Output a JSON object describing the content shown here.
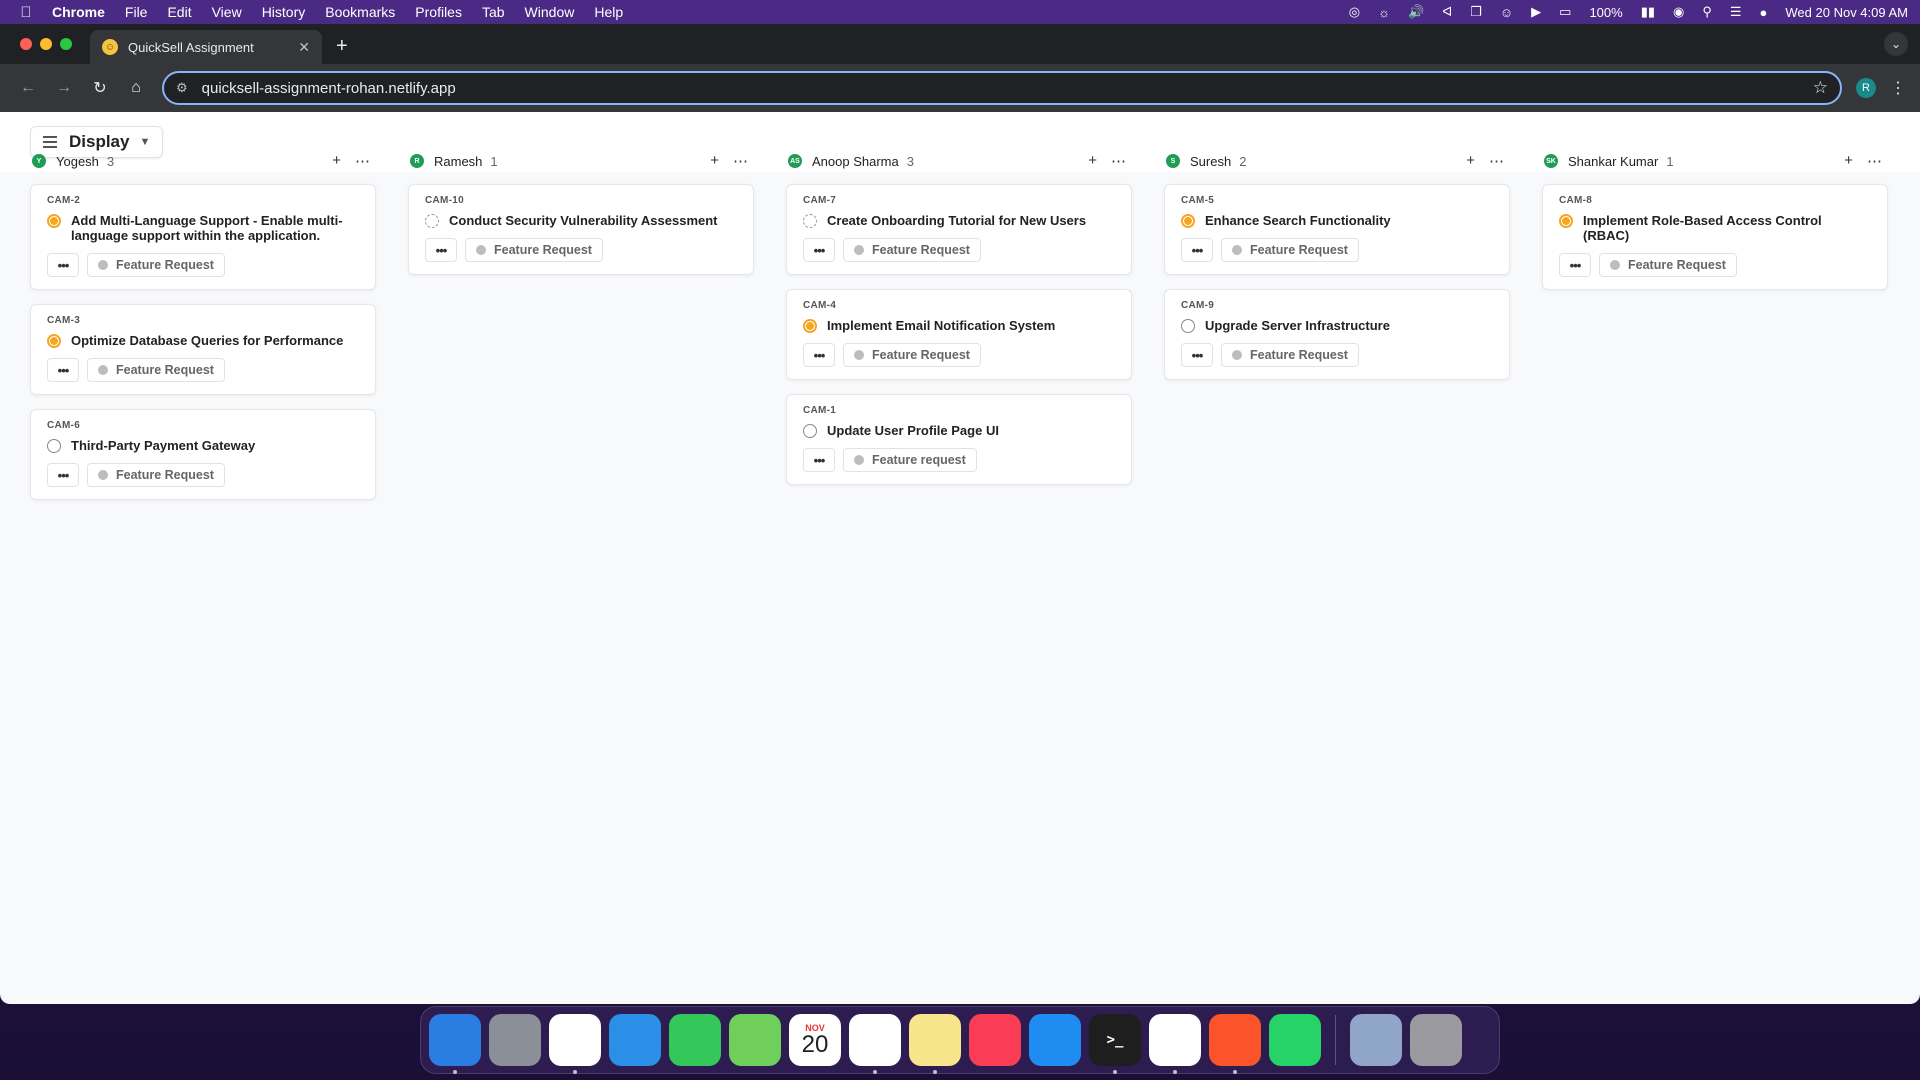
{
  "menubar": {
    "app": "Chrome",
    "items": [
      "File",
      "Edit",
      "View",
      "History",
      "Bookmarks",
      "Profiles",
      "Tab",
      "Window",
      "Help"
    ],
    "battery": "100%",
    "datetime": "Wed 20 Nov  4:09 AM"
  },
  "browser": {
    "tab_title": "QuickSell Assignment",
    "url": "quicksell-assignment-rohan.netlify.app",
    "profile_initial": "R"
  },
  "app": {
    "display_label": "Display"
  },
  "columns": [
    {
      "initials": "Y",
      "name": "Yogesh",
      "count": "3",
      "cards": [
        {
          "id": "CAM-2",
          "title": "Add Multi-Language Support - Enable multi-language support within the application.",
          "status": "progress",
          "tag": "Feature Request"
        },
        {
          "id": "CAM-3",
          "title": "Optimize Database Queries for Performance",
          "status": "progress",
          "tag": "Feature Request"
        },
        {
          "id": "CAM-6",
          "title": "Third-Party Payment Gateway",
          "status": "todo",
          "tag": "Feature Request"
        }
      ]
    },
    {
      "initials": "R",
      "name": "Ramesh",
      "count": "1",
      "cards": [
        {
          "id": "CAM-10",
          "title": "Conduct Security Vulnerability Assessment",
          "status": "backlog",
          "tag": "Feature Request"
        }
      ]
    },
    {
      "initials": "AS",
      "name": "Anoop Sharma",
      "count": "3",
      "cards": [
        {
          "id": "CAM-7",
          "title": "Create Onboarding Tutorial for New Users",
          "status": "backlog",
          "tag": "Feature Request"
        },
        {
          "id": "CAM-4",
          "title": "Implement Email Notification System",
          "status": "progress",
          "tag": "Feature Request"
        },
        {
          "id": "CAM-1",
          "title": "Update User Profile Page UI",
          "status": "todo",
          "tag": "Feature request"
        }
      ]
    },
    {
      "initials": "S",
      "name": "Suresh",
      "count": "2",
      "cards": [
        {
          "id": "CAM-5",
          "title": "Enhance Search Functionality",
          "status": "progress",
          "tag": "Feature Request"
        },
        {
          "id": "CAM-9",
          "title": "Upgrade Server Infrastructure",
          "status": "todo",
          "tag": "Feature Request"
        }
      ]
    },
    {
      "initials": "SK",
      "name": "Shankar Kumar",
      "count": "1",
      "cards": [
        {
          "id": "CAM-8",
          "title": "Implement Role-Based Access Control (RBAC)",
          "status": "progress",
          "tag": "Feature Request"
        }
      ]
    }
  ],
  "dock": {
    "calendar_month": "NOV",
    "calendar_day": "20",
    "apps": [
      {
        "icon": "finder-icon",
        "color": "#2a7de1",
        "running": true
      },
      {
        "icon": "launchpad-icon",
        "color": "#8a8f98",
        "running": false
      },
      {
        "icon": "chrome-icon",
        "color": "#ffffff",
        "running": true
      },
      {
        "icon": "safari-icon",
        "color": "#2b8fe8",
        "running": false
      },
      {
        "icon": "messages-icon",
        "color": "#34c759",
        "running": false
      },
      {
        "icon": "maps-icon",
        "color": "#6fcf5a",
        "running": false
      },
      {
        "icon": "calendar-icon",
        "color": "#ffffff",
        "running": false
      },
      {
        "icon": "photos-icon",
        "color": "#ffffff",
        "running": true
      },
      {
        "icon": "notes-icon",
        "color": "#f7e48b",
        "running": true
      },
      {
        "icon": "music-icon",
        "color": "#fa3c55",
        "running": false
      },
      {
        "icon": "app-store-icon",
        "color": "#1e8cf0",
        "running": false
      },
      {
        "icon": "terminal-icon",
        "color": "#1e1e1e",
        "running": true
      },
      {
        "icon": "vscode-icon",
        "color": "#ffffff",
        "running": true
      },
      {
        "icon": "brave-icon",
        "color": "#fb542b",
        "running": true
      },
      {
        "icon": "whatsapp-icon",
        "color": "#25d366",
        "running": false
      },
      {
        "icon": "preview-icon",
        "color": "#8fa6c8",
        "running": false
      },
      {
        "icon": "trash-icon",
        "color": "#9a9aa0",
        "running": false
      }
    ]
  }
}
